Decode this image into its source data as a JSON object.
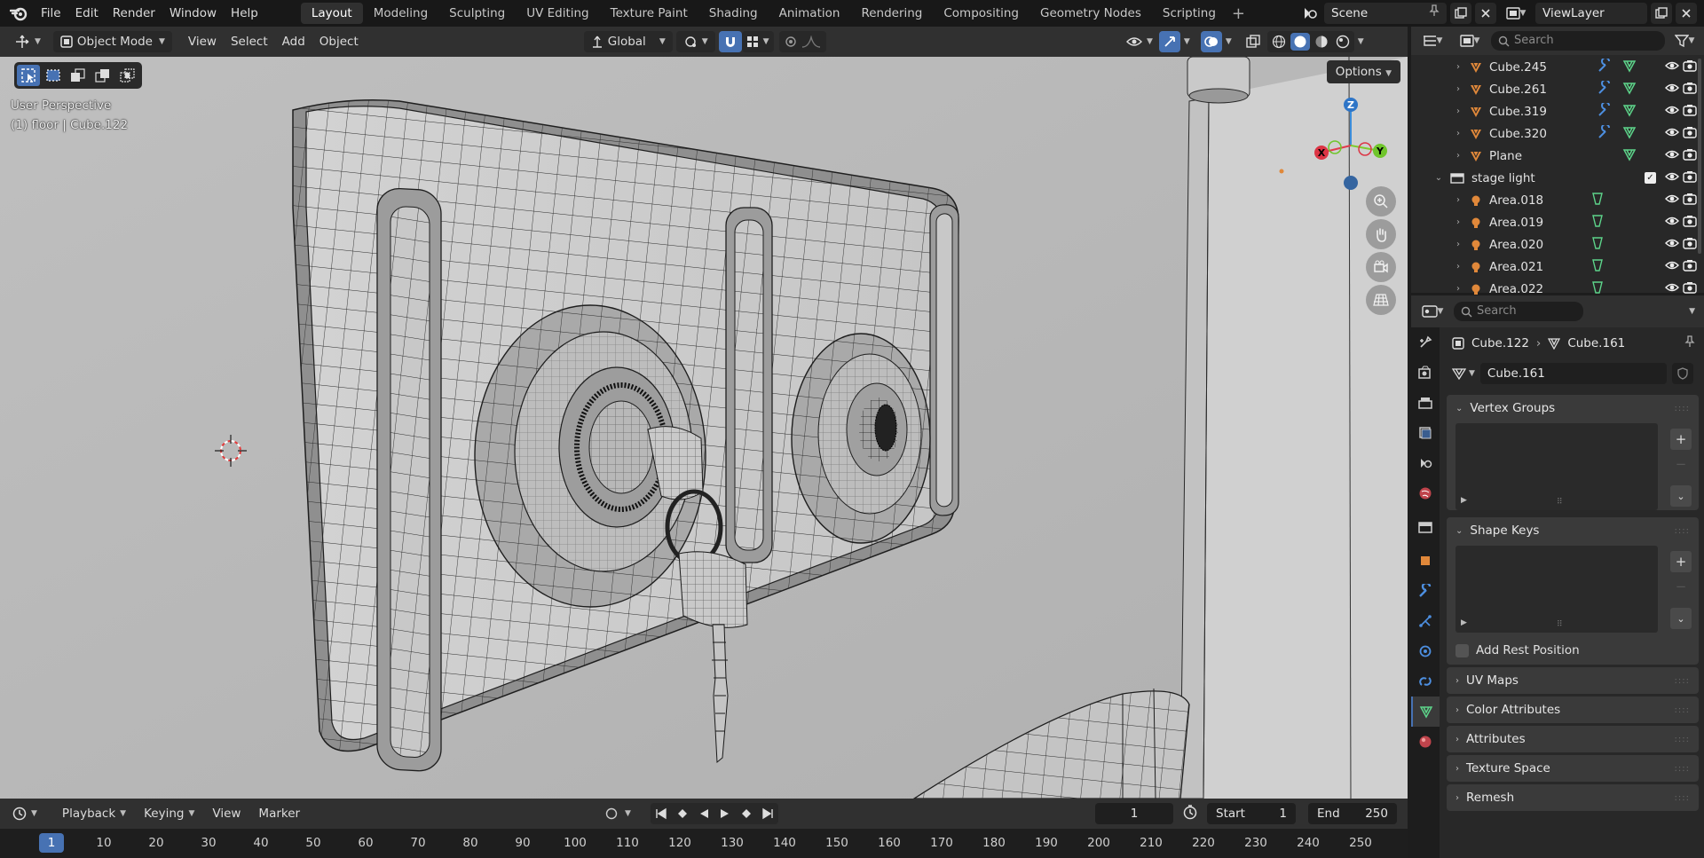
{
  "menu": [
    "File",
    "Edit",
    "Render",
    "Window",
    "Help"
  ],
  "workspaces": {
    "active": "Layout",
    "tabs": [
      "Layout",
      "Modeling",
      "Sculpting",
      "UV Editing",
      "Texture Paint",
      "Shading",
      "Animation",
      "Rendering",
      "Compositing",
      "Geometry Nodes",
      "Scripting"
    ]
  },
  "scene": {
    "name": "Scene",
    "view_layer": "ViewLayer"
  },
  "viewport_header": {
    "mode": "Object Mode",
    "menus": [
      "View",
      "Select",
      "Add",
      "Object"
    ],
    "transform_orientation": "Global"
  },
  "viewport": {
    "perspective": "User Perspective",
    "context": "(1) floor | Cube.122",
    "options_label": "Options",
    "gizmo": {
      "x": "X",
      "y": "Y",
      "z": "Z"
    }
  },
  "outliner": {
    "search_placeholder": "Search",
    "rows": [
      {
        "name": "Cube.245",
        "icon": "mesh-object-icon",
        "indent": 1
      },
      {
        "name": "Cube.261",
        "icon": "mesh-object-icon",
        "indent": 1
      },
      {
        "name": "Cube.319",
        "icon": "mesh-object-icon",
        "indent": 1
      },
      {
        "name": "Cube.320",
        "icon": "mesh-object-icon",
        "indent": 1
      },
      {
        "name": "Plane",
        "icon": "mesh-object-icon",
        "indent": 1
      },
      {
        "name": "stage light",
        "icon": "collection-icon",
        "indent": 0
      },
      {
        "name": "Area.018",
        "icon": "light-icon",
        "indent": 1
      },
      {
        "name": "Area.019",
        "icon": "light-icon",
        "indent": 1
      },
      {
        "name": "Area.020",
        "icon": "light-icon",
        "indent": 1
      },
      {
        "name": "Area.021",
        "icon": "light-icon",
        "indent": 1
      },
      {
        "name": "Area.022",
        "icon": "light-icon",
        "indent": 1
      }
    ]
  },
  "properties": {
    "search_placeholder": "Search",
    "breadcrumb": {
      "object": "Cube.122",
      "mesh": "Cube.161"
    },
    "mesh_name": "Cube.161",
    "panels": {
      "vertex_groups": "Vertex Groups",
      "shape_keys": "Shape Keys",
      "add_rest_position": "Add Rest Position",
      "uv_maps": "UV Maps",
      "color_attributes": "Color Attributes",
      "attributes": "Attributes",
      "texture_space": "Texture Space",
      "remesh": "Remesh"
    }
  },
  "timeline": {
    "menus": [
      "Playback",
      "Keying",
      "View",
      "Marker"
    ],
    "current_frame": "1",
    "start_label": "Start",
    "start": "1",
    "end_label": "End",
    "end": "250",
    "ticks": [
      "1",
      "10",
      "20",
      "30",
      "40",
      "50",
      "60",
      "70",
      "80",
      "90",
      "100",
      "110",
      "120",
      "130",
      "140",
      "150",
      "160",
      "170",
      "180",
      "190",
      "200",
      "210",
      "220",
      "230",
      "240",
      "250"
    ]
  },
  "colors": {
    "accent": "#4772b3",
    "viewport_bg": "#b9b9b9",
    "mesh_orange": "#e0883a",
    "data_green": "#5dd48a"
  }
}
